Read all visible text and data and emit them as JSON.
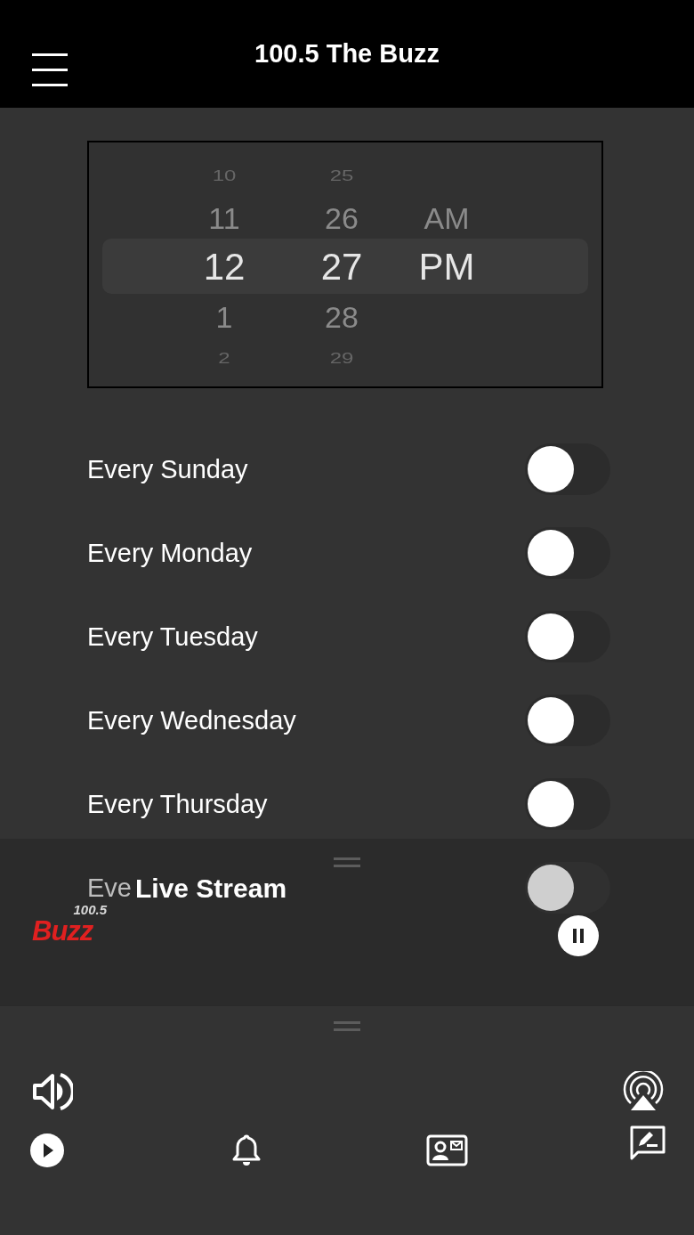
{
  "header": {
    "title": "100.5 The Buzz"
  },
  "time_picker": {
    "columns": [
      {
        "items": [
          {
            "label": "10",
            "selected": false
          },
          {
            "label": "11",
            "selected": false
          },
          {
            "label": "12",
            "selected": true
          },
          {
            "label": "1",
            "selected": false
          },
          {
            "label": "2",
            "selected": false
          }
        ]
      },
      {
        "items": [
          {
            "label": "25",
            "selected": false
          },
          {
            "label": "26",
            "selected": false
          },
          {
            "label": "27",
            "selected": true
          },
          {
            "label": "28",
            "selected": false
          },
          {
            "label": "29",
            "selected": false
          }
        ]
      },
      {
        "items": [
          {
            "label": "AM",
            "selected": false
          },
          {
            "label": "PM",
            "selected": true
          }
        ]
      }
    ]
  },
  "repeat_days": [
    {
      "label": "Every Sunday",
      "on": false
    },
    {
      "label": "Every Monday",
      "on": false
    },
    {
      "label": "Every Tuesday",
      "on": false
    },
    {
      "label": "Every Wednesday",
      "on": false
    },
    {
      "label": "Every Thursday",
      "on": false
    },
    {
      "label": "Eve",
      "on": false
    }
  ],
  "mini_player": {
    "title": "Live Stream",
    "logo": {
      "frequency": "100.5",
      "name": "Buzz"
    }
  }
}
